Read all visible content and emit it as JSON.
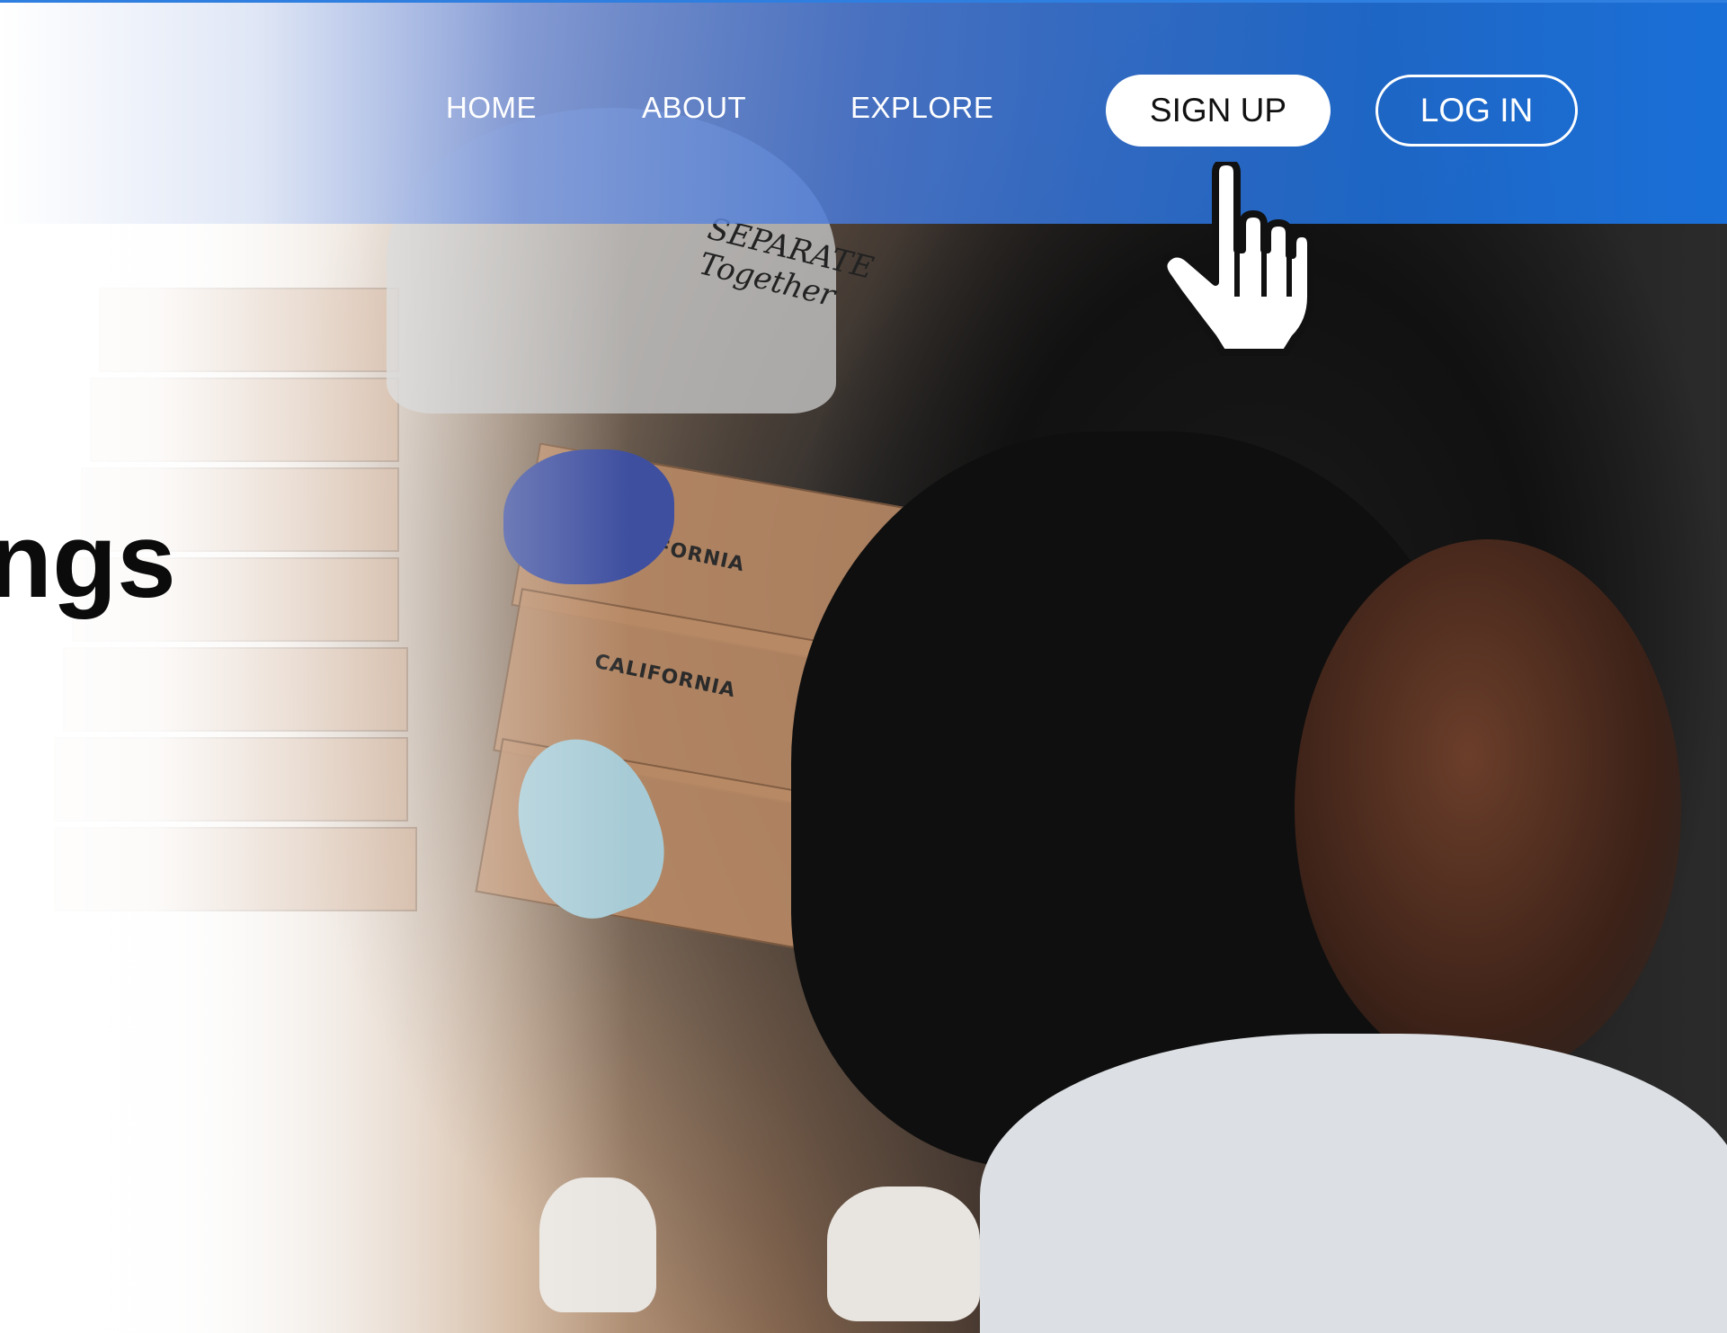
{
  "nav": {
    "items": [
      {
        "label": "HOME"
      },
      {
        "label": "ABOUT"
      },
      {
        "label": "EXPLORE"
      }
    ],
    "signup_label": "SIGN UP",
    "login_label": "LOG IN"
  },
  "hero": {
    "headline_fragment": "ngs",
    "box_print": "CALIFORNIA",
    "shirt_text": "SEPARATE Together"
  },
  "colors": {
    "header_blue": "#1f74dc",
    "signup_bg": "#ffffff",
    "text_dark": "#0b0b0b"
  },
  "icons": {
    "cursor": "pointer-hand-icon"
  }
}
